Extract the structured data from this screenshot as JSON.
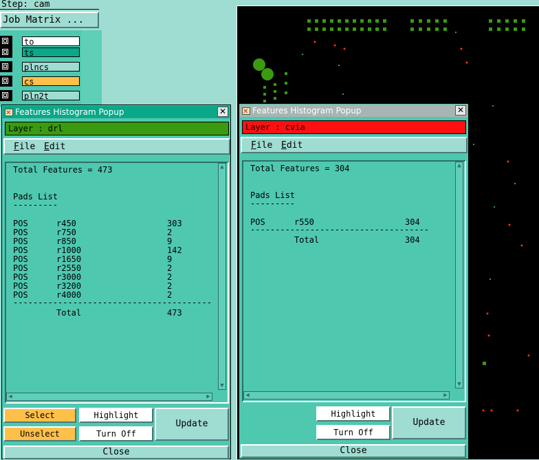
{
  "background": {
    "step_label": "Step: cam",
    "job_matrix_label": "Job Matrix ...",
    "layers": [
      {
        "name": "to",
        "color": "#ffffff"
      },
      {
        "name": "ts",
        "color": "#0aa889"
      },
      {
        "name": "plncs",
        "color": "#9fdcd2"
      },
      {
        "name": "cs",
        "color": "#ffc04a"
      },
      {
        "name": "pln2t",
        "color": "#9fdcd2"
      }
    ]
  },
  "popup_left": {
    "title": "Features Histogram Popup",
    "layer_label": "Layer :  drl",
    "layer_color": "#3a9a10",
    "menu": {
      "file": "File",
      "edit": "Edit"
    },
    "total_features": "Total Features = 473",
    "list_title": "Pads List",
    "list_underline": "---------",
    "rows": [
      {
        "pol": "POS",
        "sym": "r450",
        "count": "303"
      },
      {
        "pol": "POS",
        "sym": "r750",
        "count": "2"
      },
      {
        "pol": "POS",
        "sym": "r850",
        "count": "9"
      },
      {
        "pol": "POS",
        "sym": "r1000",
        "count": "142"
      },
      {
        "pol": "POS",
        "sym": "r1650",
        "count": "9"
      },
      {
        "pol": "POS",
        "sym": "r2550",
        "count": "2"
      },
      {
        "pol": "POS",
        "sym": "r3000",
        "count": "2"
      },
      {
        "pol": "POS",
        "sym": "r3200",
        "count": "2"
      },
      {
        "pol": "POS",
        "sym": "r4000",
        "count": "2"
      }
    ],
    "separator": "----------------------------------------",
    "total_label": "Total",
    "total_value": "473",
    "buttons": {
      "select": "Select",
      "unselect": "Unselect",
      "highlight": "Highlight",
      "turn_off": "Turn Off",
      "update": "Update",
      "close": "Close"
    }
  },
  "popup_right": {
    "title": "Features Histogram Popup",
    "layer_label": "Layer :  cvia",
    "layer_color": "#ff1010",
    "menu": {
      "file": "File",
      "edit": "Edit"
    },
    "total_features": "Total Features = 304",
    "list_title": "Pads List",
    "list_underline": "---------",
    "rows": [
      {
        "pol": "POS",
        "sym": "r550",
        "count": "304"
      }
    ],
    "separator": "------------------------------------",
    "total_label": "Total",
    "total_value": "304",
    "buttons": {
      "highlight": "Highlight",
      "turn_off": "Turn Off",
      "update": "Update",
      "close": "Close"
    }
  },
  "colors": {
    "panel": "#4fc8b0",
    "panel_light": "#9fdcd2",
    "canvas": "#000000",
    "pad_green": "#3a9a10",
    "via_red": "#ff3010"
  }
}
